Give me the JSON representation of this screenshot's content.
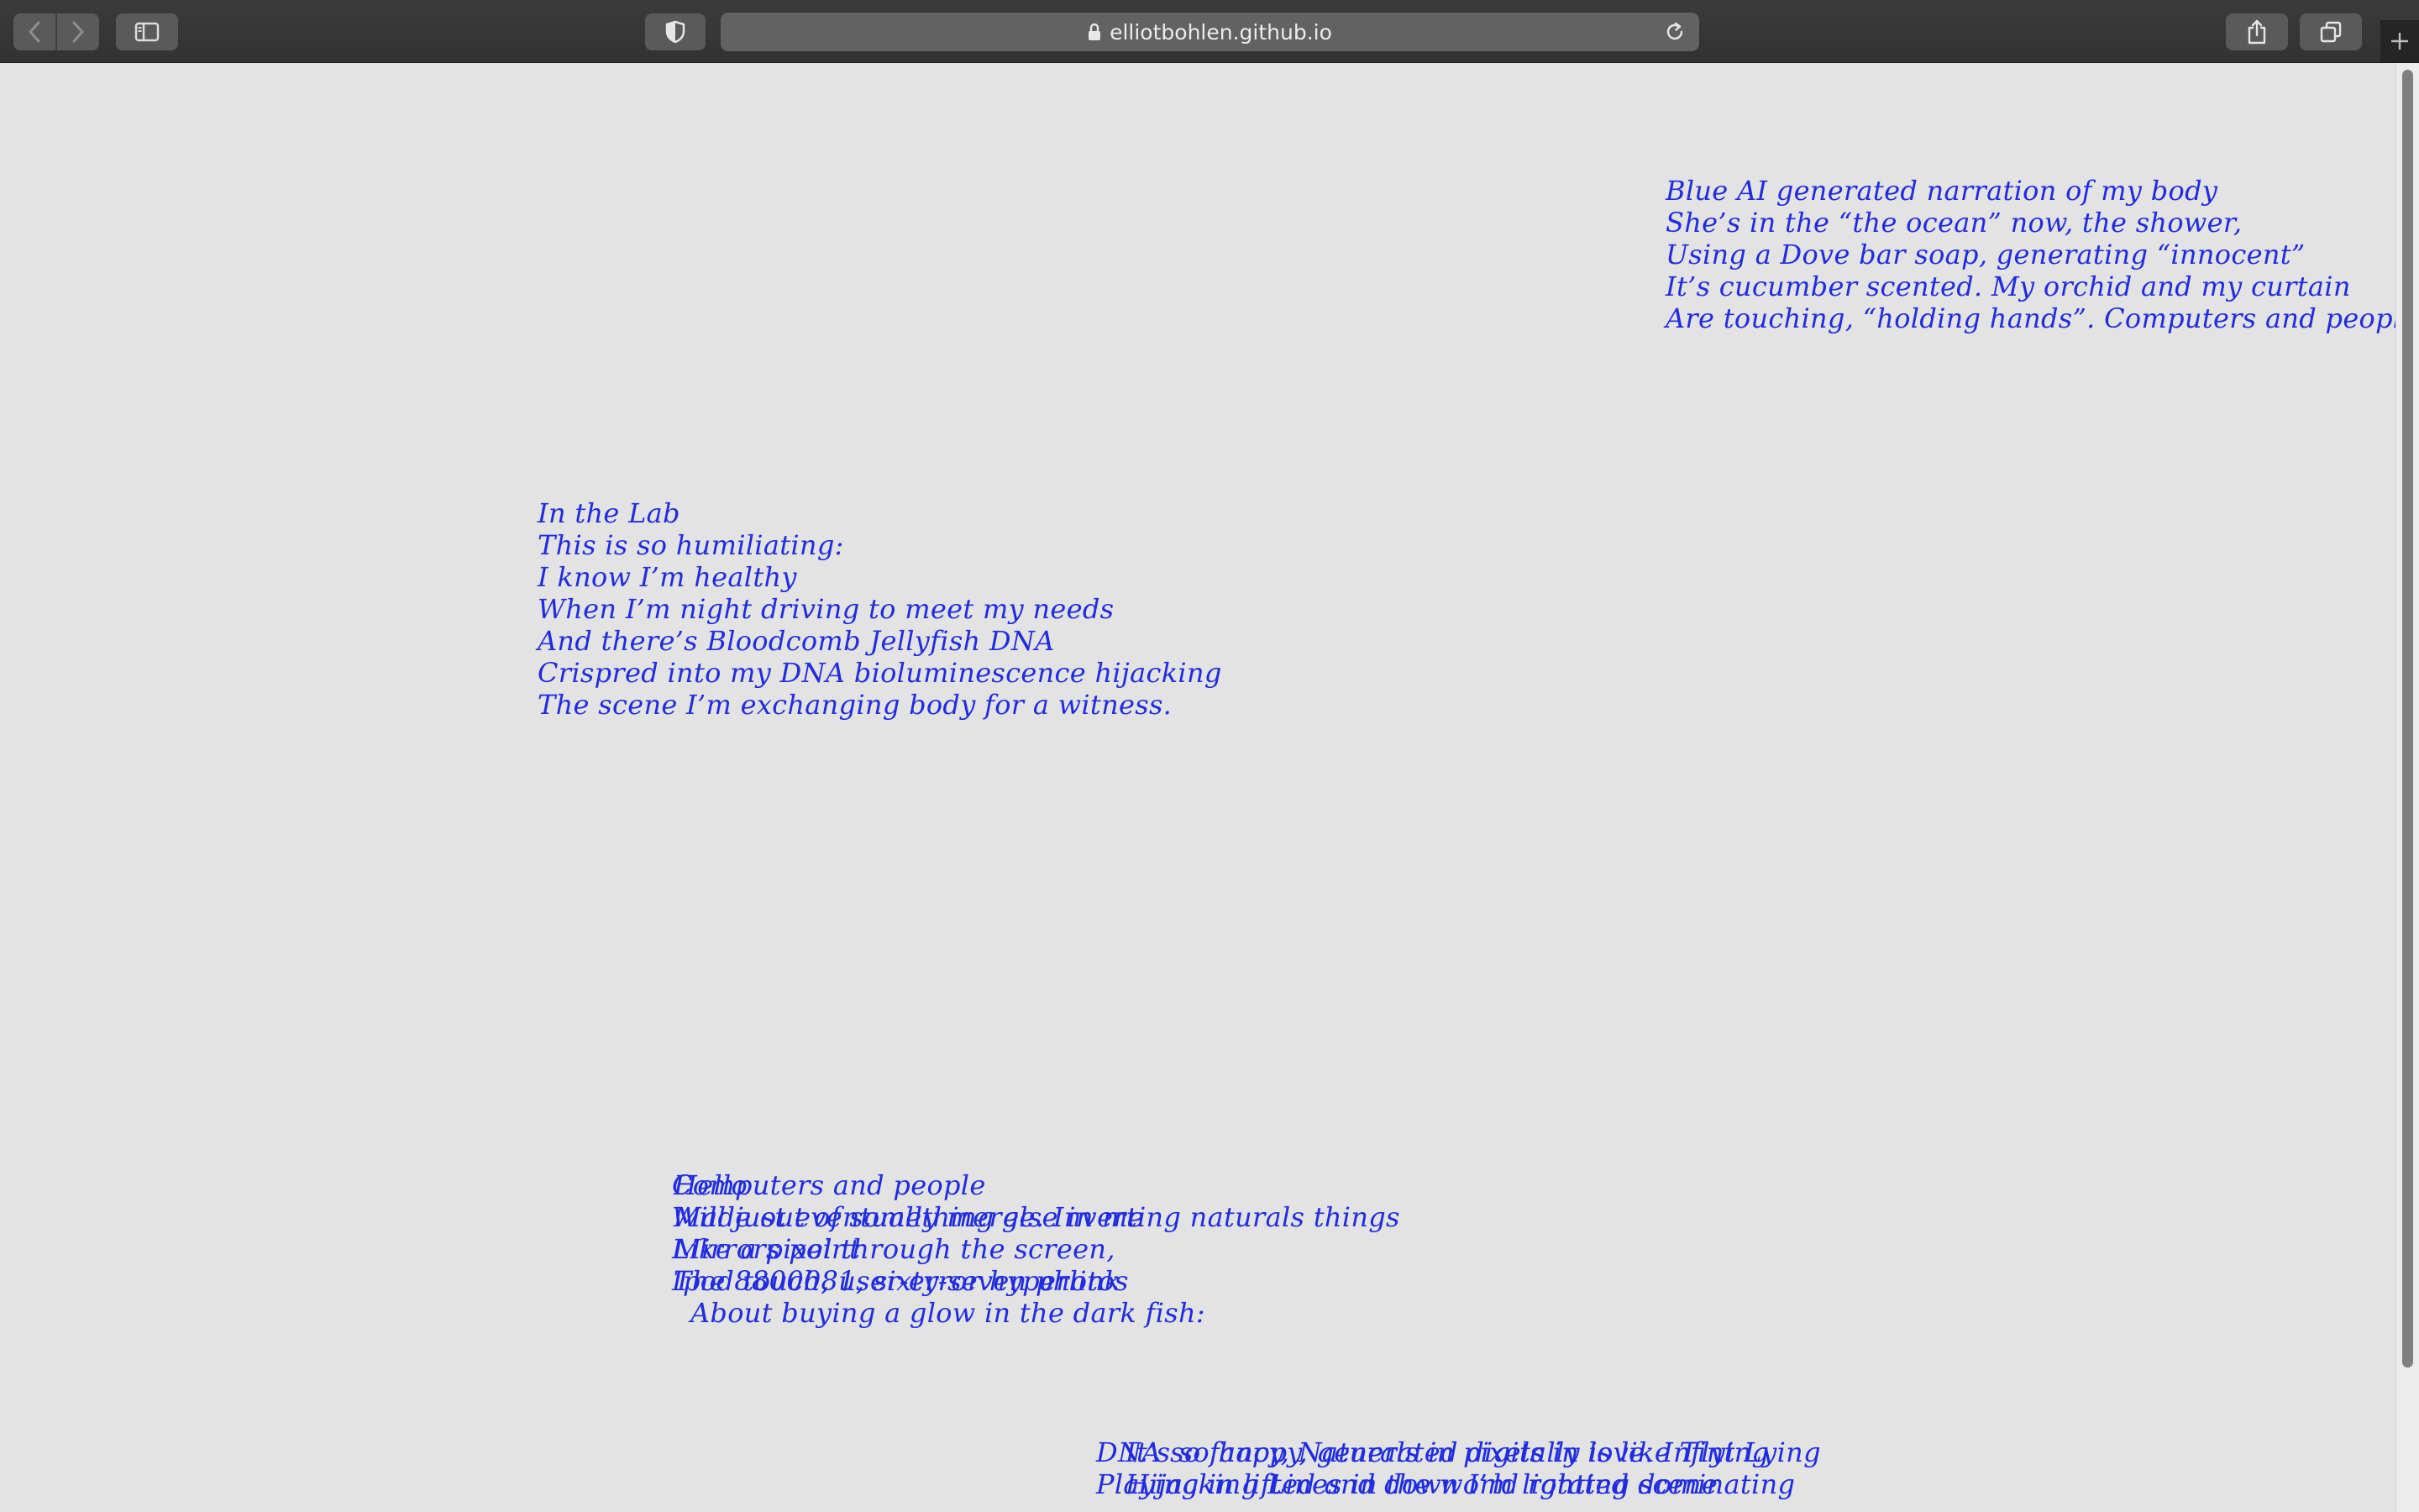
{
  "browser": {
    "url": "elliotbohlen.github.io",
    "icons": {
      "back": "chevron-left-icon",
      "forward": "chevron-right-icon",
      "sidebar": "sidebar-icon",
      "privacy": "shield-icon",
      "lock": "lock-icon",
      "reload": "reload-icon",
      "share": "share-icon",
      "tabs": "tabs-overview-icon",
      "new_tab": "plus-icon"
    }
  },
  "colors": {
    "text": "#1f2ce0",
    "page_background": "#e3e3e3",
    "toolbar": "#363636"
  },
  "poems": [
    {
      "lines": [
        "Blue AI generated narration of my body",
        "She’s in the “the ocean” now, the shower,",
        "Using a Dove bar soap, generating “innocent”",
        "It’s cucumber scented. My orchid and my curtain",
        "Are touching, “holding hands”. Computers and people"
      ]
    },
    {
      "lines": [
        "In the Lab",
        "This is so humiliating:",
        "I know I’m healthy",
        "When I’m night driving to meet my needs",
        "And there’s Bloodcomb Jellyfish DNA",
        "Crispred into my DNA bioluminescence hijacking",
        "The scene I’m exchanging body for a witness."
      ]
    },
    {
      "lines": [
        "Computers and people",
        "Will just eventually merge. Inverting naturals things",
        "Like a pixel through the screen,",
        "Ipod touch, user-error hyperlink",
        "About buying a glow in the dark fish:"
      ]
    },
    {
      "lines": [
        "Hello",
        "Made out of something else in me",
        "Mirrors point",
        "The 8800081, sixty-seven photos"
      ]
    },
    {
      "lines": [
        "DNA so fancy, Naturals in pixels in love. Inflying",
        "Playing in lifted and down I’m lighting scene"
      ]
    },
    {
      "lines": [
        "It’s so happy, generated digitally is like Tint Lying",
        "Hijacking Lines in the world rotated dominating"
      ]
    }
  ]
}
